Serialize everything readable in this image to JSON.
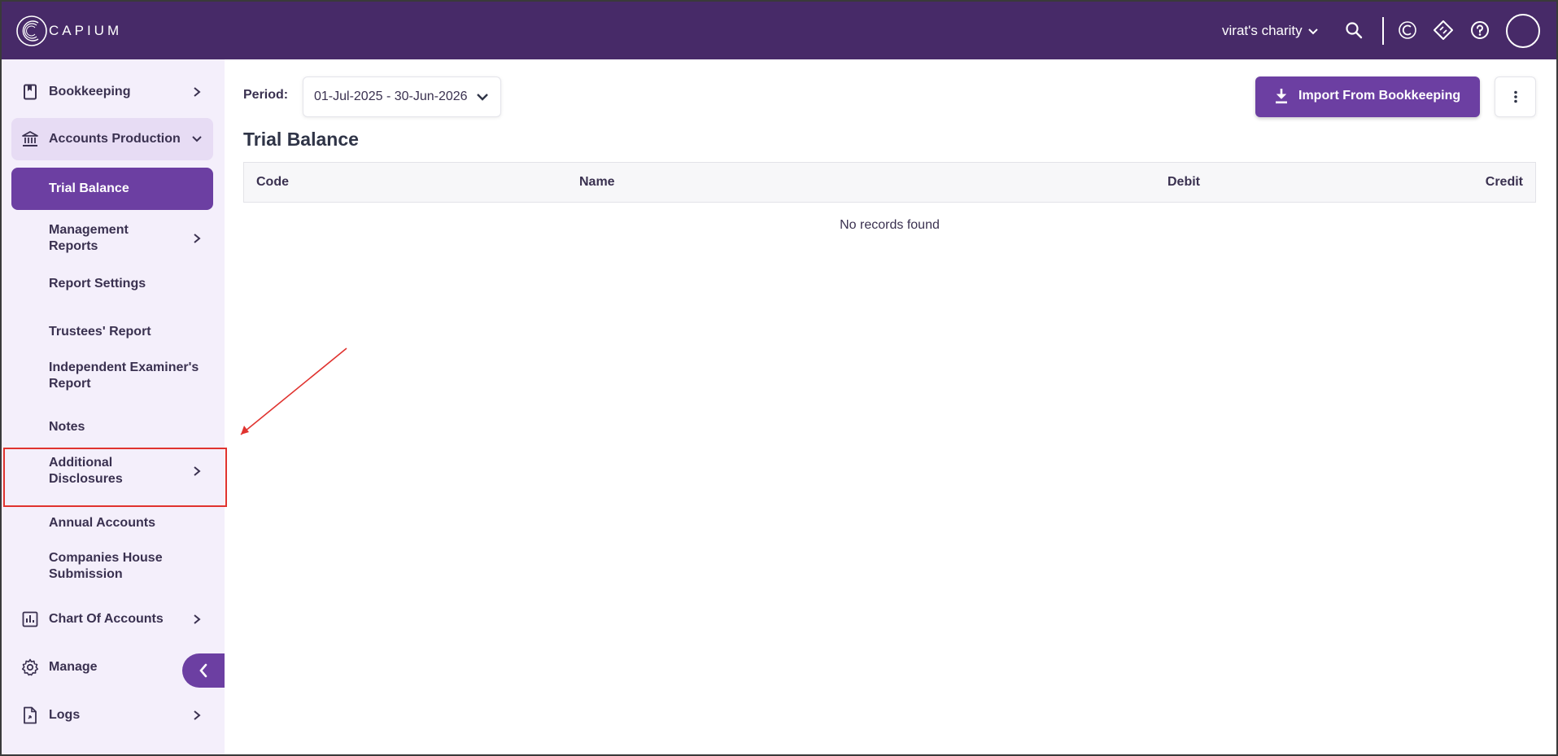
{
  "topbar": {
    "logo_text": "CAPIUM",
    "org_name": "virat's charity",
    "icons": [
      "search-icon",
      "capium-c-icon",
      "ticket-icon",
      "help-icon",
      "avatar"
    ]
  },
  "sidebar": {
    "items": [
      {
        "label": "Bookkeeping",
        "icon": "book-icon"
      },
      {
        "label": "Accounts Production",
        "icon": "bank-icon"
      },
      {
        "label": "Trial Balance"
      },
      {
        "label": "Management Reports"
      },
      {
        "label": "Report Settings"
      },
      {
        "label": "Trustees' Report"
      },
      {
        "label": "Independent Examiner's Report"
      },
      {
        "label": "Notes"
      },
      {
        "label": "Additional Disclosures"
      },
      {
        "label": "Annual Accounts"
      },
      {
        "label": "Companies House Submission"
      },
      {
        "label": "Chart Of Accounts",
        "icon": "chart-icon"
      },
      {
        "label": "Manage",
        "icon": "gear-icon"
      },
      {
        "label": "Logs",
        "icon": "file-icon"
      }
    ]
  },
  "main": {
    "period_label": "Period:",
    "period_value": "01-Jul-2025 - 30-Jun-2026",
    "import_label": "Import From Bookkeeping",
    "title": "Trial Balance",
    "table": {
      "columns": [
        "Code",
        "Name",
        "Debit",
        "Credit"
      ],
      "empty_text": "No records found"
    }
  },
  "colors": {
    "topbar": "#472a68",
    "accent": "#6c3fa2",
    "sidebar_bg": "#f4effb",
    "annotation_red": "#e0332f"
  }
}
